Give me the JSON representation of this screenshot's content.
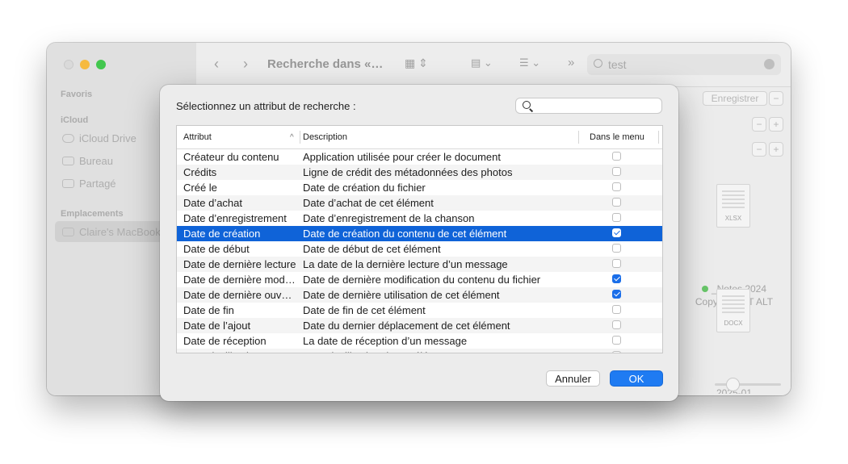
{
  "finder": {
    "title": "Recherche dans «…",
    "search_value": "test",
    "sidebar": {
      "favorites_header": "Favoris",
      "icloud_header": "iCloud",
      "icloud_drive": "iCloud Drive",
      "bureau": "Bureau",
      "partage": "Partagé",
      "locations_header": "Emplacements",
      "macbook": "Claire's MacBook"
    },
    "save_button": "Enregistrer",
    "files": [
      {
        "tag": "XLSX",
        "name_line1": "_Notes 2024",
        "name_line2": "Copywri...CIT ALT"
      },
      {
        "tag": "DOCX",
        "name_line1": "2025-01",
        "name_line2": ""
      }
    ]
  },
  "dialog": {
    "title": "Sélectionnez un attribut de recherche :",
    "search_placeholder": "",
    "columns": {
      "attribute": "Attribut",
      "description": "Description",
      "in_menu": "Dans le menu"
    },
    "rows": [
      {
        "attr": "Créateur du contenu",
        "desc": "Application utilisée pour créer le document",
        "checked": false,
        "selected": false
      },
      {
        "attr": "Crédits",
        "desc": "Ligne de crédit des métadonnées des photos",
        "checked": false,
        "selected": false
      },
      {
        "attr": "Créé le",
        "desc": "Date de création du fichier",
        "checked": false,
        "selected": false
      },
      {
        "attr": "Date d’achat",
        "desc": "Date d’achat de cet élément",
        "checked": false,
        "selected": false
      },
      {
        "attr": "Date d’enregistrement",
        "desc": "Date d’enregistrement de la chanson",
        "checked": false,
        "selected": false
      },
      {
        "attr": "Date de création",
        "desc": "Date de création du contenu de cet élément",
        "checked": true,
        "selected": true
      },
      {
        "attr": "Date de début",
        "desc": "Date de début de cet élément",
        "checked": false,
        "selected": false
      },
      {
        "attr": "Date de dernière lecture",
        "desc": "La date de la dernière lecture d’un message",
        "checked": false,
        "selected": false
      },
      {
        "attr": "Date de dernière modification",
        "desc": "Date de dernière modification du contenu du fichier",
        "checked": true,
        "selected": false
      },
      {
        "attr": "Date de dernière ouverture",
        "desc": "Date de dernière utilisation de cet élément",
        "checked": true,
        "selected": false
      },
      {
        "attr": "Date de fin",
        "desc": "Date de fin de cet élément",
        "checked": false,
        "selected": false
      },
      {
        "attr": "Date de l’ajout",
        "desc": "Date du dernier déplacement de cet élément",
        "checked": false,
        "selected": false
      },
      {
        "attr": "Date de réception",
        "desc": "La date de réception d’un message",
        "checked": false,
        "selected": false
      },
      {
        "attr": "Date d’utilisation",
        "desc": "Date d’utilisation de cet élément",
        "checked": false,
        "selected": false
      }
    ],
    "cancel_label": "Annuler",
    "ok_label": "OK"
  }
}
